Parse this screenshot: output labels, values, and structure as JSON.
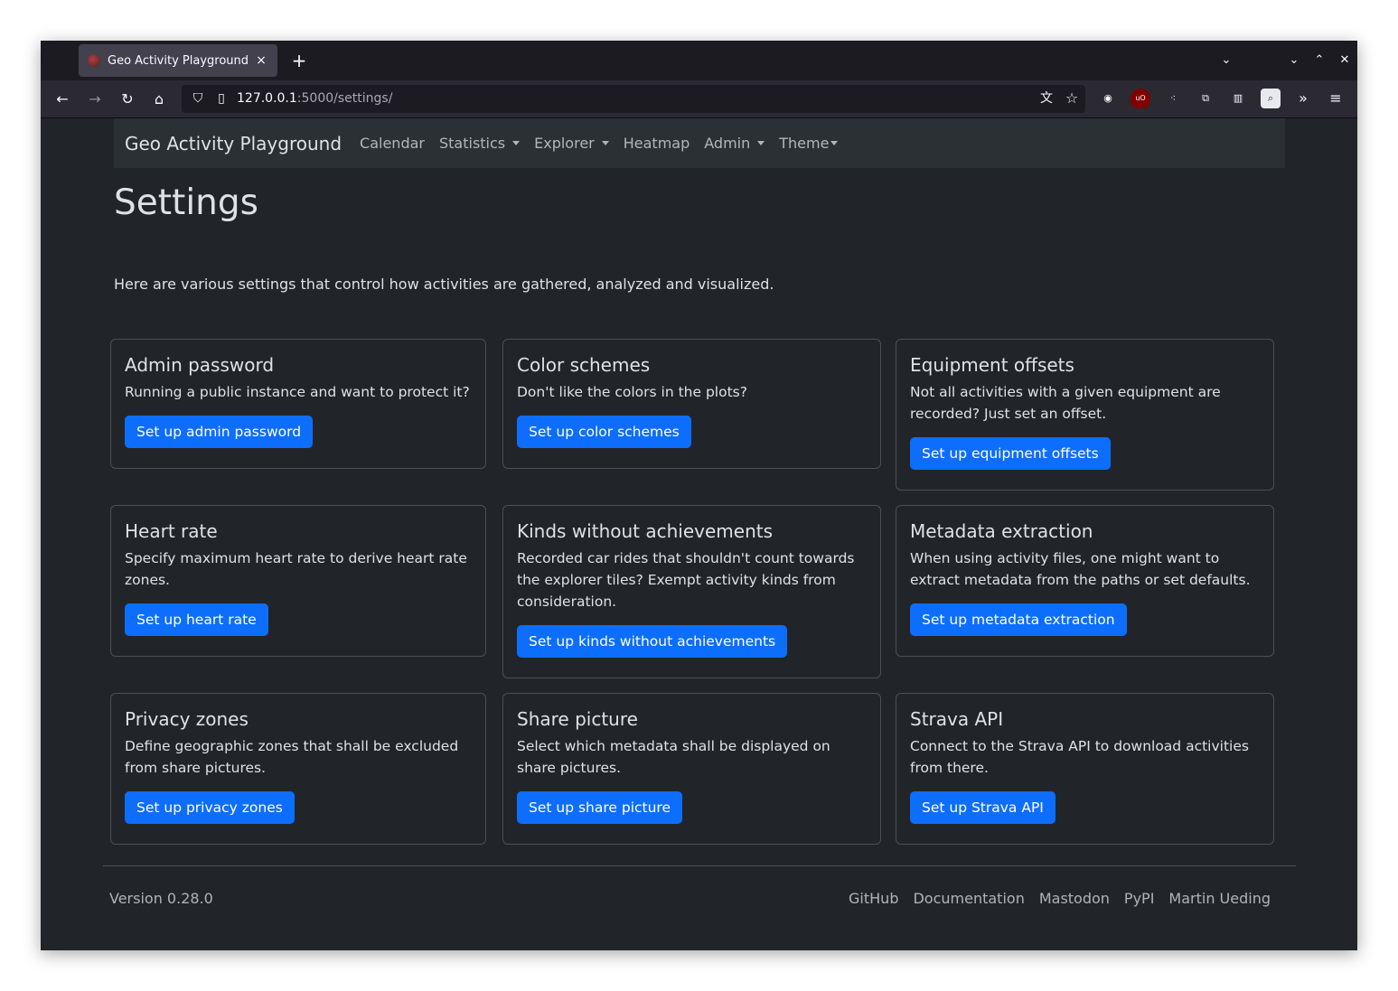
{
  "browser": {
    "tab_title": "Geo Activity Playground",
    "tab_close": "×",
    "new_tab": "+",
    "url_host": "127.0.0.1",
    "url_path": ":5000/settings/"
  },
  "navbar": {
    "brand": "Geo Activity Playground",
    "items": [
      {
        "label": "Calendar"
      },
      {
        "label": "Statistics"
      },
      {
        "label": "Explorer"
      },
      {
        "label": "Heatmap"
      },
      {
        "label": "Admin"
      },
      {
        "label": "Theme"
      }
    ]
  },
  "page": {
    "title": "Settings",
    "lead": "Here are various settings that control how activities are gathered, analyzed and visualized."
  },
  "cards": [
    {
      "title": "Admin password",
      "text": "Running a public instance and want to protect it?",
      "button": "Set up admin password"
    },
    {
      "title": "Color schemes",
      "text": "Don't like the colors in the plots?",
      "button": "Set up color schemes"
    },
    {
      "title": "Equipment offsets",
      "text": "Not all activities with a given equipment are recorded? Just set an offset.",
      "button": "Set up equipment offsets"
    },
    {
      "title": "Heart rate",
      "text": "Specify maximum heart rate to derive heart rate zones.",
      "button": "Set up heart rate"
    },
    {
      "title": "Kinds without achievements",
      "text": "Recorded car rides that shouldn't count towards the explorer tiles? Exempt activity kinds from consideration.",
      "button": "Set up kinds without achievements"
    },
    {
      "title": "Metadata extraction",
      "text": "When using activity files, one might want to extract metadata from the paths or set defaults.",
      "button": "Set up metadata extraction"
    },
    {
      "title": "Privacy zones",
      "text": "Define geographic zones that shall be excluded from share pictures.",
      "button": "Set up privacy zones"
    },
    {
      "title": "Share picture",
      "text": "Select which metadata shall be displayed on share pictures.",
      "button": "Set up share picture"
    },
    {
      "title": "Strava API",
      "text": "Connect to the Strava API to download activities from there.",
      "button": "Set up Strava API"
    }
  ],
  "footer": {
    "version": "Version 0.28.0",
    "links": [
      "GitHub",
      "Documentation",
      "Mastodon",
      "PyPI",
      "Martin Ueding"
    ]
  },
  "colors": {
    "page_bg": "#212529",
    "navbar_bg": "#2b3035",
    "primary_button": "#0d6efd",
    "card_border": "#495057"
  }
}
